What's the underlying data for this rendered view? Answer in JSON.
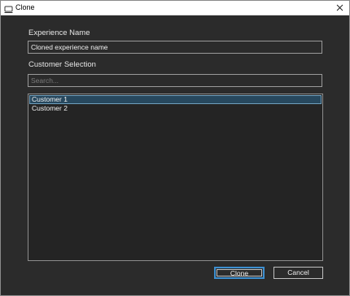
{
  "window": {
    "title": "Clone"
  },
  "form": {
    "experience_name_label": "Experience Name",
    "experience_name_value": "Cloned experience name",
    "customer_selection_label": "Customer Selection",
    "search_placeholder": "Search..."
  },
  "customers": [
    {
      "label": "Customer 1",
      "selected": true
    },
    {
      "label": "Customer 2",
      "selected": false
    }
  ],
  "buttons": {
    "clone_label": "Clone",
    "cancel_label": "Cancel"
  },
  "colors": {
    "accent": "#3d8fd0",
    "selection": "#27485e",
    "background": "#2b2b2b"
  },
  "icons": {
    "title_icon": "window-icon",
    "close_icon": "close-icon"
  }
}
